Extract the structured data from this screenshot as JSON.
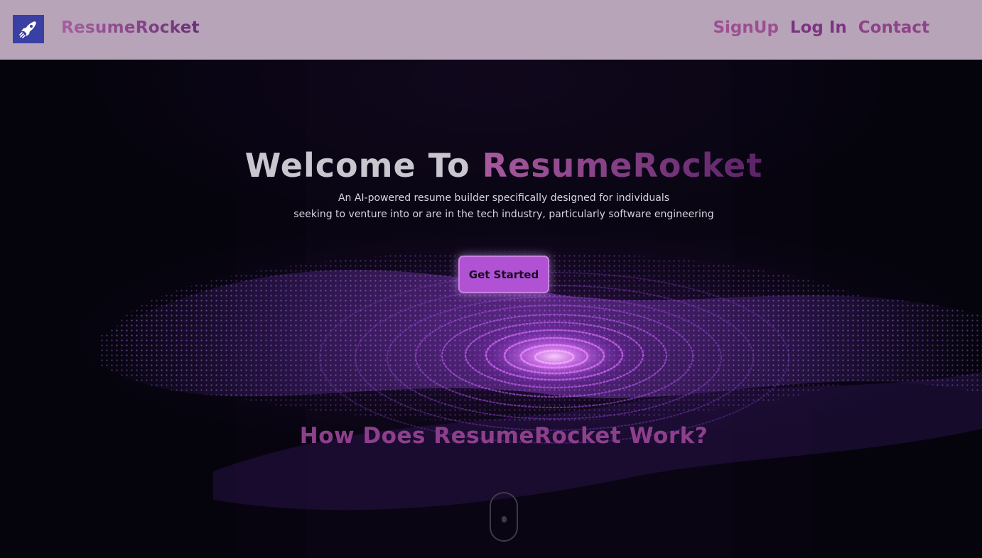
{
  "header": {
    "brand": "ResumeRocket",
    "logo_icon": "rocket-icon",
    "nav": {
      "signup": "SignUp",
      "login": "Log In",
      "contact": "Contact"
    }
  },
  "hero": {
    "title_prefix": "Welcome To",
    "title_brand": "ResumeRocket",
    "subtitle_line1": "An AI-powered resume builder specifically designed for individuals",
    "subtitle_line2": "seeking to venture into or are in the tech industry, particularly software engineering",
    "cta_label": "Get Started",
    "how_title": "How Does ResumeRocket Work?",
    "scroll_icon": "scroll-mouse-icon"
  },
  "colors": {
    "navbar_bg": "#b8a4b8",
    "logo_bg": "#3a3fa3",
    "brand_gradient": [
      "#a85fa0",
      "#6a2f78"
    ],
    "hero_bg": "#05040d",
    "cta_bg": "#b052d3",
    "accent_purple": "#8e3f8c",
    "glow": "#e9a8ff"
  }
}
